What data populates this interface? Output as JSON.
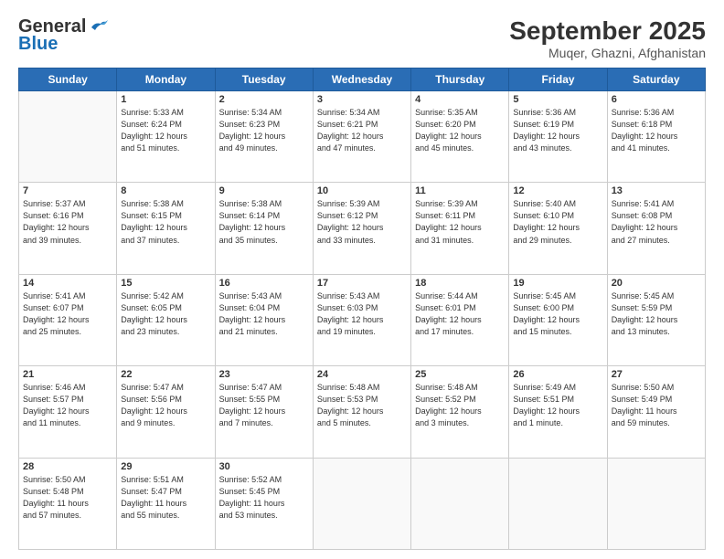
{
  "logo": {
    "general": "General",
    "blue": "Blue"
  },
  "title": "September 2025",
  "subtitle": "Muqer, Ghazni, Afghanistan",
  "headers": [
    "Sunday",
    "Monday",
    "Tuesday",
    "Wednesday",
    "Thursday",
    "Friday",
    "Saturday"
  ],
  "weeks": [
    [
      {
        "day": "",
        "info": ""
      },
      {
        "day": "1",
        "info": "Sunrise: 5:33 AM\nSunset: 6:24 PM\nDaylight: 12 hours\nand 51 minutes."
      },
      {
        "day": "2",
        "info": "Sunrise: 5:34 AM\nSunset: 6:23 PM\nDaylight: 12 hours\nand 49 minutes."
      },
      {
        "day": "3",
        "info": "Sunrise: 5:34 AM\nSunset: 6:21 PM\nDaylight: 12 hours\nand 47 minutes."
      },
      {
        "day": "4",
        "info": "Sunrise: 5:35 AM\nSunset: 6:20 PM\nDaylight: 12 hours\nand 45 minutes."
      },
      {
        "day": "5",
        "info": "Sunrise: 5:36 AM\nSunset: 6:19 PM\nDaylight: 12 hours\nand 43 minutes."
      },
      {
        "day": "6",
        "info": "Sunrise: 5:36 AM\nSunset: 6:18 PM\nDaylight: 12 hours\nand 41 minutes."
      }
    ],
    [
      {
        "day": "7",
        "info": "Sunrise: 5:37 AM\nSunset: 6:16 PM\nDaylight: 12 hours\nand 39 minutes."
      },
      {
        "day": "8",
        "info": "Sunrise: 5:38 AM\nSunset: 6:15 PM\nDaylight: 12 hours\nand 37 minutes."
      },
      {
        "day": "9",
        "info": "Sunrise: 5:38 AM\nSunset: 6:14 PM\nDaylight: 12 hours\nand 35 minutes."
      },
      {
        "day": "10",
        "info": "Sunrise: 5:39 AM\nSunset: 6:12 PM\nDaylight: 12 hours\nand 33 minutes."
      },
      {
        "day": "11",
        "info": "Sunrise: 5:39 AM\nSunset: 6:11 PM\nDaylight: 12 hours\nand 31 minutes."
      },
      {
        "day": "12",
        "info": "Sunrise: 5:40 AM\nSunset: 6:10 PM\nDaylight: 12 hours\nand 29 minutes."
      },
      {
        "day": "13",
        "info": "Sunrise: 5:41 AM\nSunset: 6:08 PM\nDaylight: 12 hours\nand 27 minutes."
      }
    ],
    [
      {
        "day": "14",
        "info": "Sunrise: 5:41 AM\nSunset: 6:07 PM\nDaylight: 12 hours\nand 25 minutes."
      },
      {
        "day": "15",
        "info": "Sunrise: 5:42 AM\nSunset: 6:05 PM\nDaylight: 12 hours\nand 23 minutes."
      },
      {
        "day": "16",
        "info": "Sunrise: 5:43 AM\nSunset: 6:04 PM\nDaylight: 12 hours\nand 21 minutes."
      },
      {
        "day": "17",
        "info": "Sunrise: 5:43 AM\nSunset: 6:03 PM\nDaylight: 12 hours\nand 19 minutes."
      },
      {
        "day": "18",
        "info": "Sunrise: 5:44 AM\nSunset: 6:01 PM\nDaylight: 12 hours\nand 17 minutes."
      },
      {
        "day": "19",
        "info": "Sunrise: 5:45 AM\nSunset: 6:00 PM\nDaylight: 12 hours\nand 15 minutes."
      },
      {
        "day": "20",
        "info": "Sunrise: 5:45 AM\nSunset: 5:59 PM\nDaylight: 12 hours\nand 13 minutes."
      }
    ],
    [
      {
        "day": "21",
        "info": "Sunrise: 5:46 AM\nSunset: 5:57 PM\nDaylight: 12 hours\nand 11 minutes."
      },
      {
        "day": "22",
        "info": "Sunrise: 5:47 AM\nSunset: 5:56 PM\nDaylight: 12 hours\nand 9 minutes."
      },
      {
        "day": "23",
        "info": "Sunrise: 5:47 AM\nSunset: 5:55 PM\nDaylight: 12 hours\nand 7 minutes."
      },
      {
        "day": "24",
        "info": "Sunrise: 5:48 AM\nSunset: 5:53 PM\nDaylight: 12 hours\nand 5 minutes."
      },
      {
        "day": "25",
        "info": "Sunrise: 5:48 AM\nSunset: 5:52 PM\nDaylight: 12 hours\nand 3 minutes."
      },
      {
        "day": "26",
        "info": "Sunrise: 5:49 AM\nSunset: 5:51 PM\nDaylight: 12 hours\nand 1 minute."
      },
      {
        "day": "27",
        "info": "Sunrise: 5:50 AM\nSunset: 5:49 PM\nDaylight: 11 hours\nand 59 minutes."
      }
    ],
    [
      {
        "day": "28",
        "info": "Sunrise: 5:50 AM\nSunset: 5:48 PM\nDaylight: 11 hours\nand 57 minutes."
      },
      {
        "day": "29",
        "info": "Sunrise: 5:51 AM\nSunset: 5:47 PM\nDaylight: 11 hours\nand 55 minutes."
      },
      {
        "day": "30",
        "info": "Sunrise: 5:52 AM\nSunset: 5:45 PM\nDaylight: 11 hours\nand 53 minutes."
      },
      {
        "day": "",
        "info": ""
      },
      {
        "day": "",
        "info": ""
      },
      {
        "day": "",
        "info": ""
      },
      {
        "day": "",
        "info": ""
      }
    ]
  ]
}
